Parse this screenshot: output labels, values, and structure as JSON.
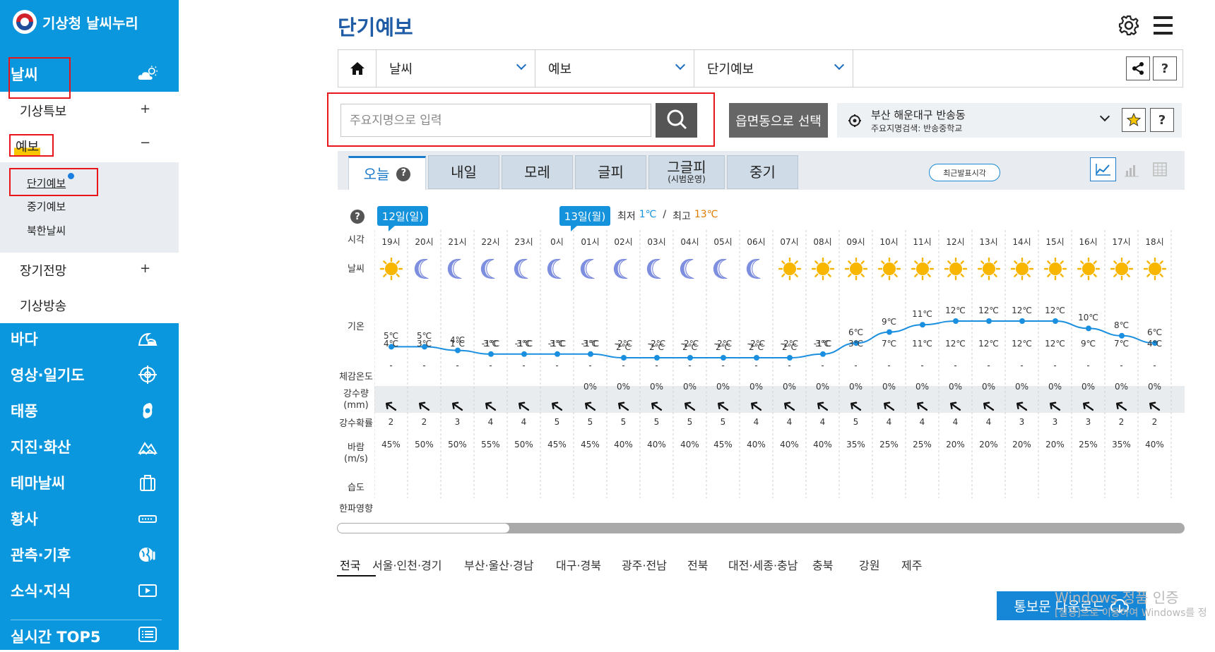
{
  "sidebar": {
    "logo_text": "기상청 날씨누리",
    "weather_label": "날씨",
    "sub_items": [
      {
        "label": "기상특보",
        "toggle": "+"
      },
      {
        "label": "예보",
        "toggle": "−"
      },
      {
        "label": "장기전망",
        "toggle": "+"
      },
      {
        "label": "기상방송",
        "toggle": ""
      }
    ],
    "forecast_sub": [
      "단기예보",
      "중기예보",
      "북한날씨"
    ],
    "main_items": [
      {
        "label": "바다",
        "icon": "wave-icon"
      },
      {
        "label": "영상·일기도",
        "icon": "satellite-target-icon"
      },
      {
        "label": "태풍",
        "icon": "typhoon-icon"
      },
      {
        "label": "지진·화산",
        "icon": "earthquake-icon"
      },
      {
        "label": "테마날씨",
        "icon": "bag-icon"
      },
      {
        "label": "황사",
        "icon": "dust-icon"
      },
      {
        "label": "관측·기후",
        "icon": "globe-thermometer-icon"
      },
      {
        "label": "소식·지식",
        "icon": "video-icon"
      }
    ],
    "top5_label": "실시간 TOP5"
  },
  "header": {
    "title": "단기예보",
    "breadcrumb": [
      "날씨",
      "예보",
      "단기예보"
    ]
  },
  "search": {
    "placeholder": "주요지명으로 입력",
    "region_button": "읍면동으로 선택",
    "location": "부산 해운대구 반송동",
    "location_sub": "주요지명검색: 반송중학교"
  },
  "tabs": [
    {
      "label": "오늘",
      "sub": "",
      "active": true
    },
    {
      "label": "내일",
      "sub": ""
    },
    {
      "label": "모레",
      "sub": ""
    },
    {
      "label": "글피",
      "sub": ""
    },
    {
      "label": "그글피",
      "sub": "(시범운영)"
    },
    {
      "label": "중기",
      "sub": ""
    }
  ],
  "latest_time_label": "최근발표시각",
  "forecast": {
    "day1_label": "12일(일)",
    "day2_label": "13일(월)",
    "minmax": {
      "min_label": "최저",
      "min": "1℃",
      "sep": "/",
      "max_label": "최고",
      "max": "13℃"
    },
    "row_labels": {
      "time": "시각",
      "weather": "날씨",
      "temp": "기온",
      "feels": "체감온도",
      "precip": "강수량",
      "precip_unit": "(mm)",
      "prob": "강수확률",
      "wind": "바람",
      "wind_unit": "(m/s)",
      "humidity": "습도",
      "cold": "한파영향"
    },
    "hours": [
      "19시",
      "20시",
      "21시",
      "22시",
      "23시",
      "0시",
      "01시",
      "02시",
      "03시",
      "04시",
      "05시",
      "06시",
      "07시",
      "08시",
      "09시",
      "10시",
      "11시",
      "12시",
      "13시",
      "14시",
      "15시",
      "16시",
      "17시",
      "18시"
    ],
    "sky": [
      "sun",
      "moon",
      "moon",
      "moon",
      "moon",
      "moon",
      "moon",
      "moon",
      "moon",
      "moon",
      "moon",
      "moon",
      "sun",
      "sun",
      "sun",
      "sun",
      "sun",
      "sun",
      "sun",
      "sun",
      "sun",
      "sun",
      "sun",
      "sun"
    ],
    "temps": [
      5,
      5,
      4,
      3,
      3,
      3,
      3,
      2,
      2,
      2,
      2,
      2,
      2,
      3,
      6,
      9,
      11,
      12,
      12,
      12,
      12,
      10,
      8,
      6
    ],
    "temp_labels": [
      "5℃",
      "5℃",
      "4℃",
      "3℃",
      "3℃",
      "3℃",
      "3℃",
      "2℃",
      "2℃",
      "2℃",
      "2℃",
      "2℃",
      "2℃",
      "3℃",
      "6℃",
      "9℃",
      "11℃",
      "12℃",
      "12℃",
      "12℃",
      "12℃",
      "10℃",
      "8℃",
      "6℃"
    ],
    "feels": [
      "4℃",
      "3℃",
      "1℃",
      "-1℃",
      "-1℃",
      "-1℃",
      "-1℃",
      "-2℃",
      "-2℃",
      "-2℃",
      "-2℃",
      "-2℃",
      "-2℃",
      "-1℃",
      "3℃",
      "7℃",
      "11℃",
      "12℃",
      "12℃",
      "12℃",
      "12℃",
      "9℃",
      "7℃",
      "4℃"
    ],
    "precip": [
      "-",
      "-",
      "-",
      "-",
      "-",
      "-",
      "-",
      "-",
      "-",
      "-",
      "-",
      "-",
      "-",
      "-",
      "-",
      "-",
      "-",
      "-",
      "-",
      "-",
      "-",
      "-",
      "-",
      "-"
    ],
    "prob": [
      "",
      "",
      "",
      "",
      "",
      "",
      "0%",
      "0%",
      "0%",
      "0%",
      "0%",
      "0%",
      "0%",
      "0%",
      "0%",
      "0%",
      "0%",
      "0%",
      "0%",
      "0%",
      "0%",
      "0%",
      "0%",
      "0%"
    ],
    "wind": [
      "2",
      "2",
      "3",
      "4",
      "4",
      "5",
      "5",
      "5",
      "5",
      "5",
      "5",
      "4",
      "4",
      "4",
      "5",
      "4",
      "4",
      "4",
      "4",
      "3",
      "3",
      "3",
      "2",
      "2"
    ],
    "humidity": [
      "45%",
      "50%",
      "50%",
      "55%",
      "50%",
      "45%",
      "45%",
      "40%",
      "40%",
      "40%",
      "45%",
      "40%",
      "40%",
      "40%",
      "35%",
      "25%",
      "25%",
      "20%",
      "20%",
      "20%",
      "20%",
      "25%",
      "35%",
      "40%"
    ]
  },
  "regions": [
    "전국",
    "서울·인천·경기",
    "부산·울산·경남",
    "대구·경북",
    "광주·전남",
    "전북",
    "대전·세종·충남",
    "충북",
    "강원",
    "제주"
  ],
  "download_label": "통보문 다운로드",
  "watermark": {
    "line1": "Windows 정품 인증",
    "line2": "[설정]으로 이동하여 Windows를 정"
  },
  "colors": {
    "sidebar": "#0b97dd",
    "title": "#1f5ca6",
    "accent": "#1592dc",
    "line": "#1a8fe0"
  }
}
